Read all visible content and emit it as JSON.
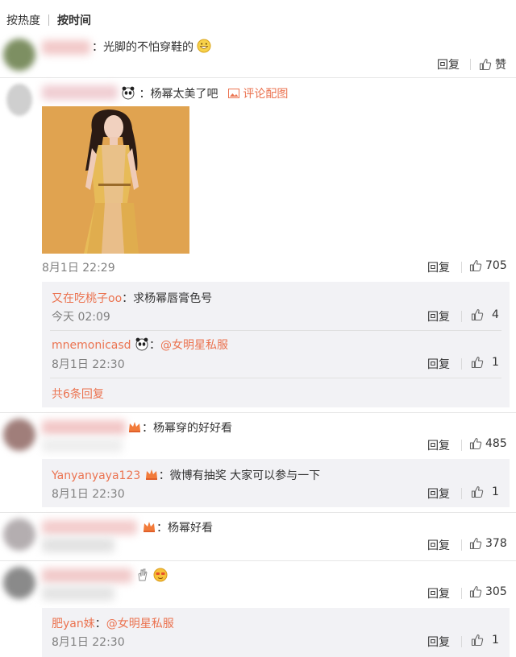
{
  "sort": {
    "by_hot": "按热度",
    "by_time": "按时间"
  },
  "comments": [
    {
      "text": "：光脚的不怕穿鞋的",
      "reply": "回复",
      "like": "赞"
    },
    {
      "text": "：杨幂太美了吧",
      "pic_link": "评论配图",
      "time": "8月1日 22:29",
      "reply": "回复",
      "likes": "705",
      "sub": [
        {
          "user": "又在吃桃子oo",
          "text": "：求杨幂唇膏色号",
          "time": "今天 02:09",
          "reply": "回复",
          "likes": "4"
        },
        {
          "user": "mnemonicasd",
          "text": "：",
          "mention": "@女明星私服",
          "time": "8月1日 22:30",
          "reply": "回复",
          "likes": "1"
        }
      ],
      "more": "共6条回复"
    },
    {
      "text": "：杨幂穿的好好看",
      "reply": "回复",
      "likes": "485",
      "sub": [
        {
          "user": "Yanyanyaya123",
          "text": "：微博有抽奖 大家可以参与一下",
          "time": "8月1日 22:30",
          "reply": "回复",
          "likes": "1"
        }
      ]
    },
    {
      "text": "：杨幂好看",
      "reply": "回复",
      "likes": "378"
    },
    {
      "reply": "回复",
      "likes": "305",
      "sub": [
        {
          "user": "肥yan妹",
          "text": "：",
          "mention": "@女明星私服",
          "time": "8月1日 22:30",
          "reply": "回复",
          "likes": "1"
        }
      ]
    }
  ],
  "colors": {
    "link": "#eb7350",
    "sub_bg": "#f2f2f5",
    "time": "#808080"
  }
}
